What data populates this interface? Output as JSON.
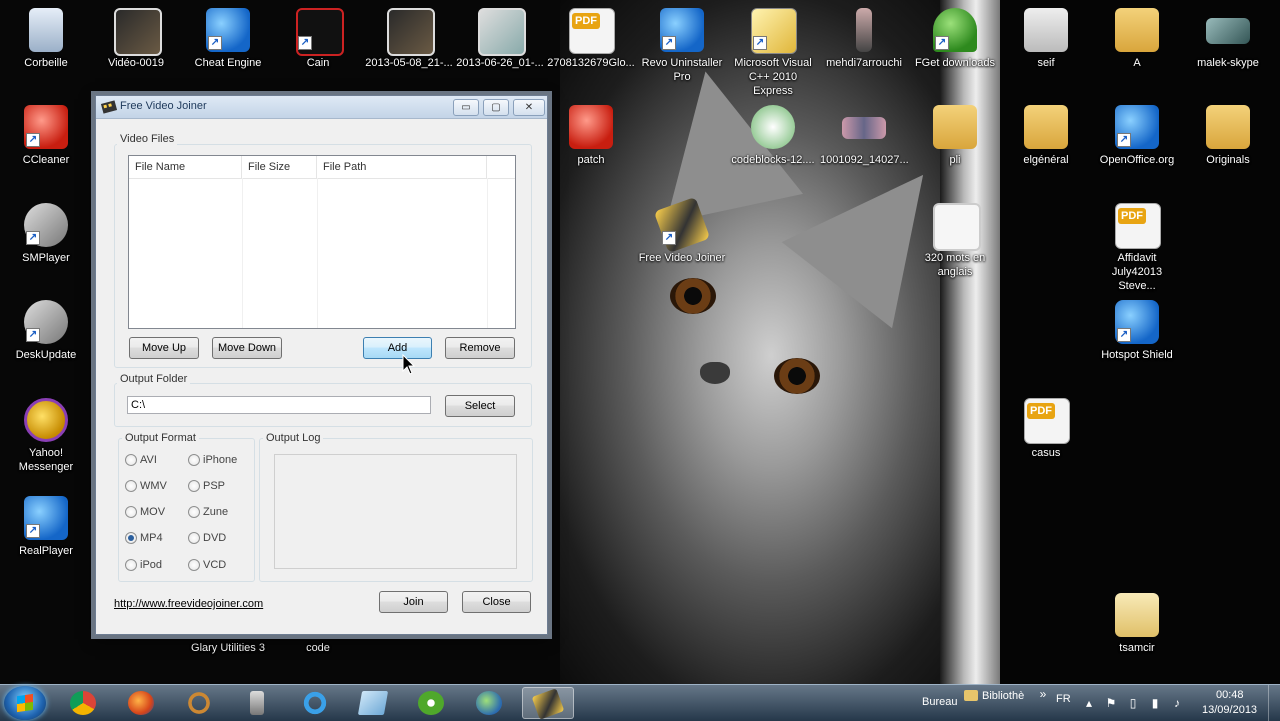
{
  "desktop": {
    "icons": [
      {
        "label": "Corbeille",
        "icon": "recycle-bin-icon"
      },
      {
        "label": "Vidéo-0019",
        "icon": "video-thumbnail-icon"
      },
      {
        "label": "Cheat Engine",
        "icon": "cheat-engine-icon"
      },
      {
        "label": "Cain",
        "icon": "cain-icon"
      },
      {
        "label": "2013-05-08_21-...",
        "icon": "video-file-icon"
      },
      {
        "label": "2013-06-26_01-...",
        "icon": "video-file-icon"
      },
      {
        "label": "2708132679Glo...",
        "icon": "pdf-file-icon"
      },
      {
        "label": "Revo Uninstaller Pro",
        "icon": "revo-uninstaller-icon"
      },
      {
        "label": "Microsoft Visual C++ 2010 Express",
        "icon": "visual-cpp-icon"
      },
      {
        "label": "mehdi7arrouchi",
        "icon": "image-file-icon"
      },
      {
        "label": "FGet downloads",
        "icon": "fget-icon"
      },
      {
        "label": "seif",
        "icon": "image-file-icon"
      },
      {
        "label": "A",
        "icon": "folder-icon"
      },
      {
        "label": "malek-skype",
        "icon": "image-file-icon"
      },
      {
        "label": "CCleaner",
        "icon": "ccleaner-icon"
      },
      {
        "label": "patch",
        "icon": "patch-icon"
      },
      {
        "label": "codeblocks-12....",
        "icon": "codeblocks-icon"
      },
      {
        "label": "1001092_14027...",
        "icon": "image-file-icon"
      },
      {
        "label": "pli",
        "icon": "folder-icon"
      },
      {
        "label": "elgénéral",
        "icon": "folder-icon"
      },
      {
        "label": "OpenOffice.org",
        "icon": "openoffice-icon"
      },
      {
        "label": "Originals",
        "icon": "folder-icon"
      },
      {
        "label": "SMPlayer",
        "icon": "smplayer-icon"
      },
      {
        "label": "Free Video Joiner",
        "icon": "free-video-joiner-icon"
      },
      {
        "label": "320 mots en anglais",
        "icon": "video-file-icon"
      },
      {
        "label": "Affidavit July42013 Steve...",
        "icon": "pdf-file-icon"
      },
      {
        "label": "DeskUpdate",
        "icon": "deskupdate-icon"
      },
      {
        "label": "Hotspot Shield",
        "icon": "hotspot-shield-icon"
      },
      {
        "label": "Yahoo! Messenger",
        "icon": "yahoo-messenger-icon"
      },
      {
        "label": "casus",
        "icon": "pdf-file-icon"
      },
      {
        "label": "RealPlayer",
        "icon": "realplayer-icon"
      },
      {
        "label": "Glary Utilities 3",
        "icon": "glary-utilities-icon"
      },
      {
        "label": "code",
        "icon": "code-icon"
      },
      {
        "label": "tsamcir",
        "icon": "folder-icon"
      }
    ]
  },
  "window": {
    "title": "Free Video Joiner",
    "controls": {
      "minimize": "▭",
      "maximize": "▢",
      "close": "✕"
    },
    "video_files": {
      "group_label": "Video Files",
      "columns": [
        "File Name",
        "File Size",
        "File Path"
      ],
      "rows": [],
      "buttons": {
        "move_up": "Move Up",
        "move_down": "Move Down",
        "add": "Add",
        "remove": "Remove"
      }
    },
    "output_folder": {
      "group_label": "Output Folder",
      "value": "C:\\",
      "select_label": "Select"
    },
    "output_format": {
      "group_label": "Output Format",
      "options": [
        "AVI",
        "iPhone",
        "WMV",
        "PSP",
        "MOV",
        "Zune",
        "MP4",
        "DVD",
        "iPod",
        "VCD"
      ],
      "selected": "MP4"
    },
    "output_log": {
      "group_label": "Output Log",
      "content": ""
    },
    "link": "http://www.freevideojoiner.com",
    "join_label": "Join",
    "close_label": "Close"
  },
  "taskbar": {
    "apps": [
      {
        "icon": "chrome-icon"
      },
      {
        "icon": "firefox-icon"
      },
      {
        "icon": "ccleaner-taskbar-icon"
      },
      {
        "icon": "speaker-app-icon"
      },
      {
        "icon": "internet-explorer-icon"
      },
      {
        "icon": "notepad-icon"
      },
      {
        "icon": "utorrent-icon"
      },
      {
        "icon": "network-app-icon"
      },
      {
        "icon": "free-video-joiner-icon"
      }
    ],
    "toolbars": {
      "bureau": "Bureau",
      "bibliotheques": "Bibliothè"
    },
    "language": "FR",
    "clock": {
      "time": "00:48",
      "date": "13/09/2013"
    }
  },
  "colors": {
    "accent": "#3c7fb1",
    "window_bg": "#f0f0f0",
    "title_text": "#1e395b"
  }
}
